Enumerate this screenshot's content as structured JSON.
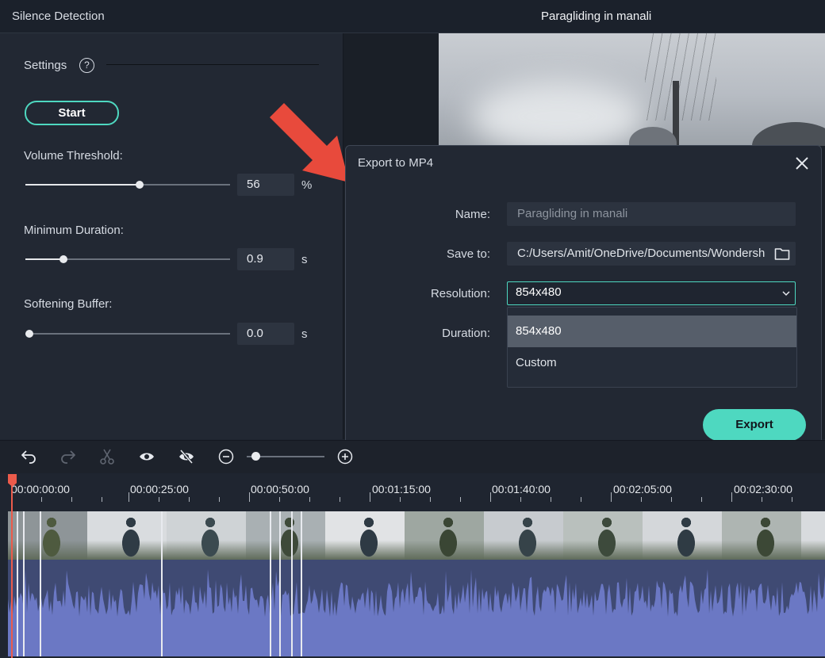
{
  "window": {
    "left_title": "Silence Detection",
    "center_title": "Paragliding in manali"
  },
  "settings": {
    "label": "Settings",
    "help_icon": "?",
    "start_label": "Start",
    "params": [
      {
        "label": "Volume Threshold:",
        "value": "56",
        "unit": "%",
        "slider_fraction": 0.56
      },
      {
        "label": "Minimum Duration:",
        "value": "0.9",
        "unit": "s",
        "slider_fraction": 0.18
      },
      {
        "label": "Softening Buffer:",
        "value": "0.0",
        "unit": "s",
        "slider_fraction": 0.0
      }
    ]
  },
  "dialog": {
    "title": "Export to MP4",
    "name_label": "Name:",
    "name_placeholder": "Paragliding in manali",
    "save_label": "Save to:",
    "save_path": "C:/Users/Amit/OneDrive/Documents/Wondersh",
    "resolution_label": "Resolution:",
    "resolution_value": "854x480",
    "duration_label": "Duration:",
    "resolution_options": [
      "854x480",
      "Custom"
    ],
    "export_label": "Export"
  },
  "toolbar": {
    "icons": [
      "undo-icon",
      "redo-icon",
      "scissors-icon",
      "eye-icon",
      "eye-slash-icon",
      "zoom-out-icon",
      "zoom-in-icon"
    ],
    "zoom_fraction": 0.1
  },
  "timeline": {
    "ticks": [
      "00:00:00:00",
      "00:00:25:00",
      "00:00:50:00",
      "00:01:15:00",
      "00:01:40:00",
      "00:02:05:00",
      "00:02:30:00"
    ]
  },
  "colors": {
    "accent": "#4ed8c0",
    "playhead": "#ec5b4b",
    "audio": "#6b78c4",
    "arrow": "#e84a3c"
  }
}
